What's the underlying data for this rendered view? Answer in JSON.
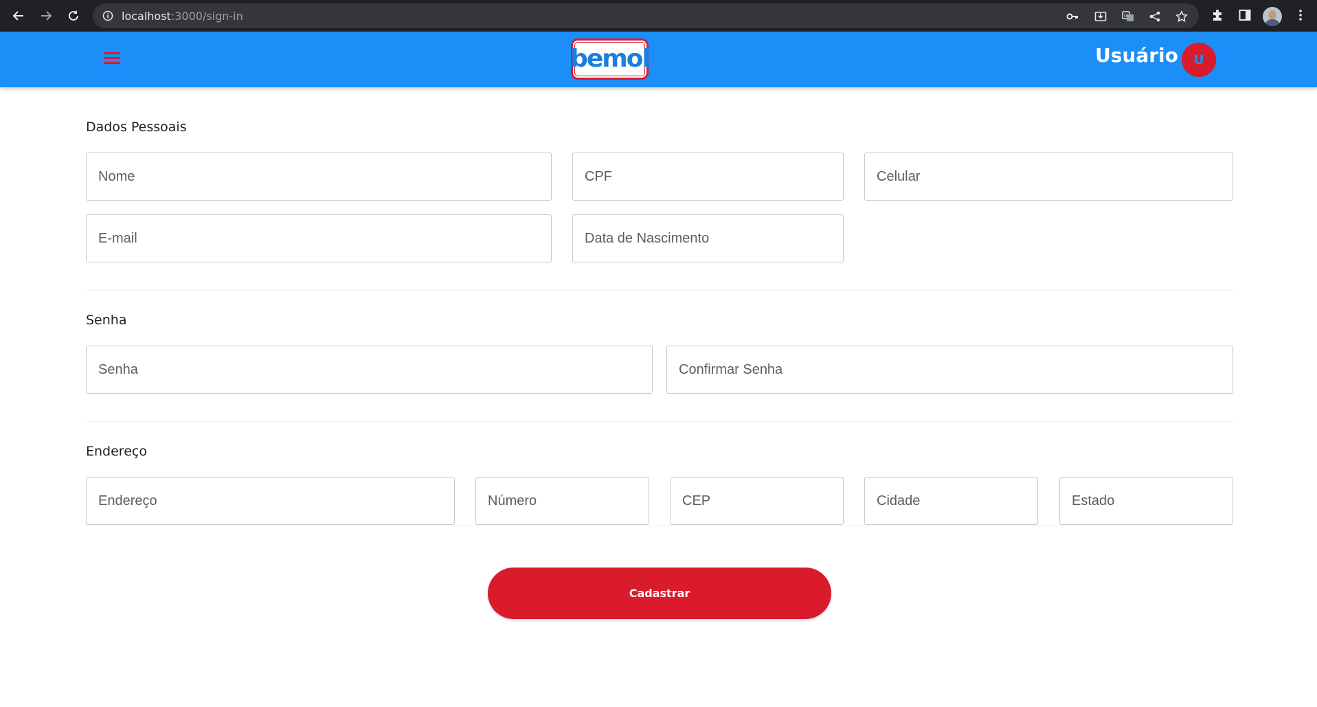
{
  "browser": {
    "url_host": "localhost",
    "url_path": ":3000/sign-in"
  },
  "header": {
    "logo_text": "bemol",
    "user_label": "Usuário",
    "avatar_letter": "U",
    "colors": {
      "bar": "#1b8ef8",
      "accent": "#d91b2c"
    }
  },
  "sections": {
    "personal": {
      "title": "Dados Pessoais",
      "nome": "Nome",
      "cpf": "CPF",
      "celular": "Celular",
      "email": "E-mail",
      "nascimento": "Data de Nascimento"
    },
    "password": {
      "title": "Senha",
      "senha": "Senha",
      "confirmar": "Confirmar Senha"
    },
    "address": {
      "title": "Endereço",
      "endereco": "Endereço",
      "numero": "Número",
      "cep": "CEP",
      "cidade": "Cidade",
      "estado": "Estado"
    }
  },
  "submit_label": "Cadastrar"
}
